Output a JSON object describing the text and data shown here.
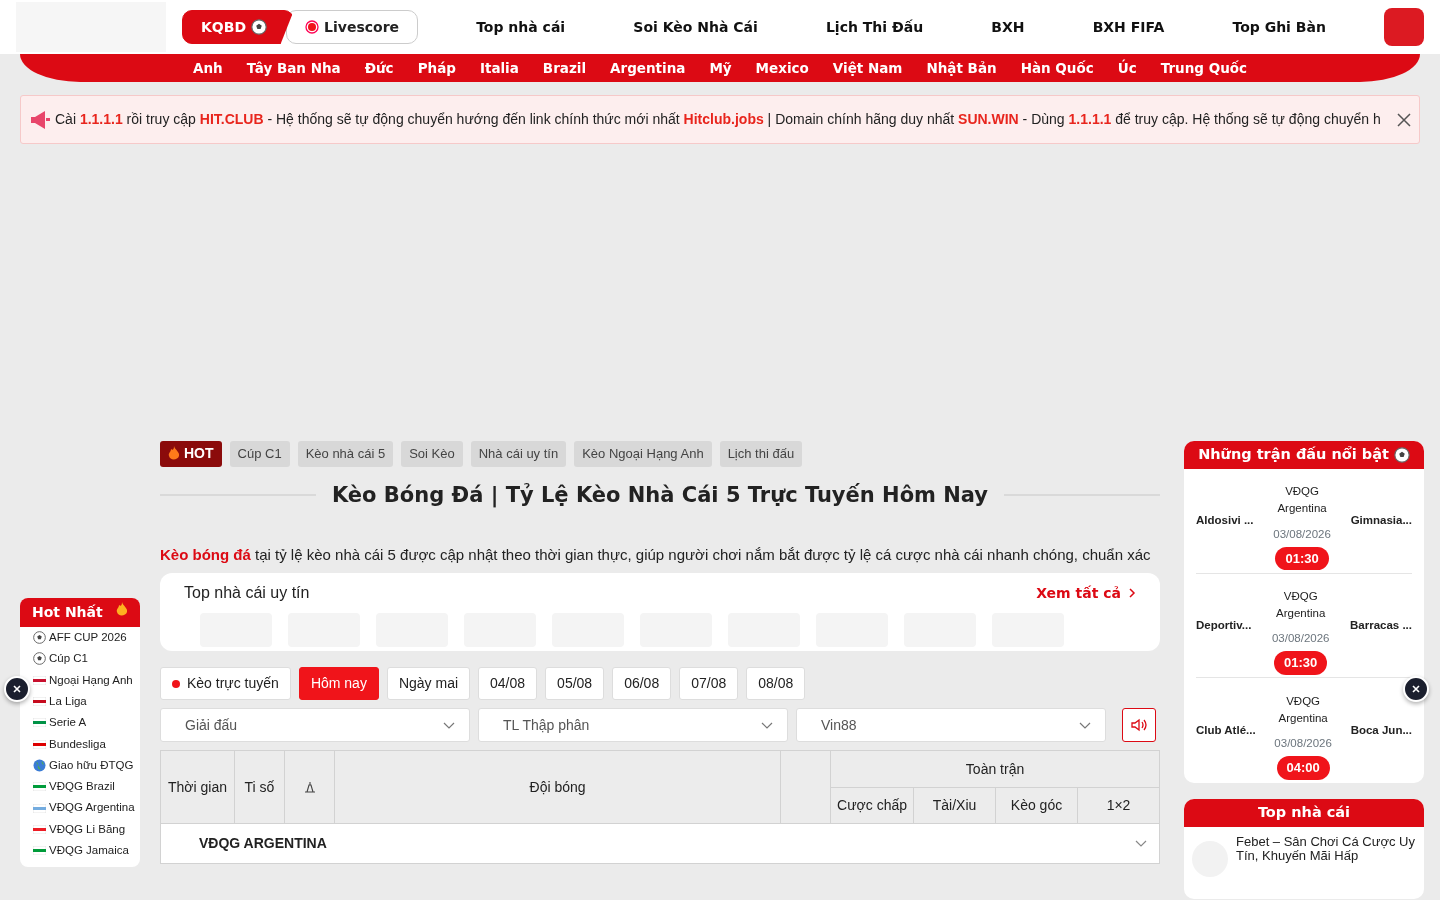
{
  "header": {
    "mode_buttons": [
      {
        "label": "KQBD",
        "kind": "ball",
        "selected": true
      },
      {
        "label": "Livescore",
        "kind": "live",
        "selected": false
      }
    ],
    "nav": [
      "Top nhà cái",
      "Soi Kèo Nhà Cái",
      "Lịch Thi Đấu",
      "BXH",
      "BXH FIFA",
      "Top Ghi Bàn"
    ]
  },
  "countries": [
    "Anh",
    "Tây Ban Nha",
    "Đức",
    "Pháp",
    "Italia",
    "Brazil",
    "Argentina",
    "Mỹ",
    "Mexico",
    "Việt Nam",
    "Nhật Bản",
    "Hàn Quốc",
    "Úc",
    "Trung Quốc"
  ],
  "notice": {
    "text": "Cài **1.1.1.1** rồi truy cập **HIT.CLUB** - Hệ thống sẽ tự động chuyển hướng đến link chính thức mới nhất **Hitclub.jobs** | Domain chính hãng duy nhất **SUN.WIN** - Dùng **1.1.1.1** để truy cập. Hệ thống sẽ tự động chuyển h"
  },
  "tags": [
    {
      "label": "HOT",
      "kind": "hot"
    },
    {
      "label": "Cúp C1",
      "kind": "tag"
    },
    {
      "label": "Kèo nhà cái 5",
      "kind": "tag"
    },
    {
      "label": "Soi Kèo",
      "kind": "tag"
    },
    {
      "label": "Nhà cái uy tín",
      "kind": "tag"
    },
    {
      "label": "Kèo Ngoại Hạng Anh",
      "kind": "tag"
    },
    {
      "label": "Lịch thi đấu",
      "kind": "tag"
    }
  ],
  "title": "Kèo Bóng Đá | Tỷ Lệ Kèo Nhà Cái 5 Trực Tuyến Hôm Nay",
  "intro": "**Kèo bóng đá** tại tỷ lệ kèo nhà cái 5 được cập nhật theo thời gian thực, giúp người chơi nắm bắt được tỷ lệ cá cược nhà cái nhanh chóng, chuẩn xác",
  "top_bookmakers": {
    "title": "Top nhà cái uy tín",
    "link": "Xem tất cả"
  },
  "date_tabs": [
    {
      "label": "Kèo trực tuyến",
      "kind": "live",
      "selected": false
    },
    {
      "label": "Hôm nay",
      "kind": "day",
      "selected": true
    },
    {
      "label": "Ngày mai",
      "kind": "day",
      "selected": false
    },
    {
      "label": "04/08",
      "kind": "day",
      "selected": false
    },
    {
      "label": "05/08",
      "kind": "day",
      "selected": false
    },
    {
      "label": "06/08",
      "kind": "day",
      "selected": false
    },
    {
      "label": "07/08",
      "kind": "day",
      "selected": false
    },
    {
      "label": "08/08",
      "kind": "day",
      "selected": false
    }
  ],
  "filters": [
    {
      "value": "Giải đấu"
    },
    {
      "value": "TL Thập phân"
    },
    {
      "value": "Vin88"
    }
  ],
  "table": {
    "columns": [
      "Thời gian",
      "Ti số",
      "Đội bóng"
    ],
    "group_header": "Toàn trận",
    "sub_columns": [
      "Cược chấp",
      "Tài/Xiu",
      "Kèo góc",
      "1×2"
    ],
    "leagues": [
      {
        "name": "VĐQG ARGENTINA",
        "expanded": true
      }
    ]
  },
  "hot_list": {
    "title": "Hot Nhất",
    "items": [
      {
        "name": "AFF CUP 2026",
        "kind": "ball"
      },
      {
        "name": "Cúp C1",
        "kind": "ball"
      },
      {
        "name": "Ngoại Hạng Anh",
        "kind": "flag",
        "color": "#c8102e"
      },
      {
        "name": "La Liga",
        "kind": "flag",
        "color": "#c60b1e"
      },
      {
        "name": "Serie A",
        "kind": "flag",
        "color": "#009246"
      },
      {
        "name": "Bundesliga",
        "kind": "flag",
        "color": "#dd0000"
      },
      {
        "name": "Giao hữu ĐTQG",
        "kind": "globe"
      },
      {
        "name": "VĐQG Brazil",
        "kind": "flag",
        "color": "#009c3b"
      },
      {
        "name": "VĐQG Argentina",
        "kind": "flag",
        "color": "#74acdf"
      },
      {
        "name": "VĐQG Li Băng",
        "kind": "flag",
        "color": "#ed1c24"
      },
      {
        "name": "VĐQG Jamaica",
        "kind": "flag",
        "color": "#009b3a"
      }
    ]
  },
  "featured": {
    "title": "Những trận đấu nổi bật",
    "matches": [
      {
        "league": "VĐQG Argentina",
        "date": "03/08/2026",
        "home": "Aldosivi ...",
        "away": "Gimnasia...",
        "time": "01:30"
      },
      {
        "league": "VĐQG Argentina",
        "date": "03/08/2026",
        "home": "Deportiv...",
        "away": "Barracas ...",
        "time": "01:30"
      },
      {
        "league": "VĐQG Argentina",
        "date": "03/08/2026",
        "home": "Club Atlé...",
        "away": "Boca Jun...",
        "time": "04:00"
      }
    ]
  },
  "top_sites": {
    "title": "Top nhà cái",
    "items": [
      "Febet – Sân Chơi Cá Cược Uy Tín, Khuyến Mãi Hấp"
    ]
  }
}
